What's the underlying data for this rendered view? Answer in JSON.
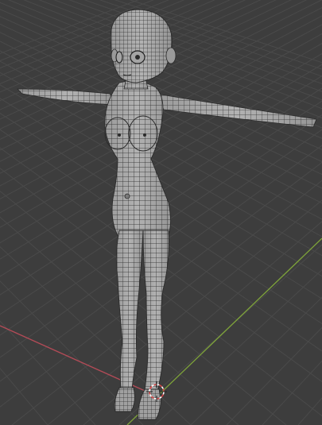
{
  "viewport": {
    "background": "#3d3d3d",
    "grid_color": "#4a4a4a",
    "x_axis_color": "#b34b57",
    "y_axis_color": "#7ea33a"
  },
  "model": {
    "mesh_fill": "#a9a9a9",
    "mesh_shadow": "#8e8e8e",
    "wire_color": "#2b2b2b"
  },
  "scene": {
    "cursor_icon": "3d-cursor-icon",
    "cursor_color_a": "#ffffff",
    "cursor_color_b": "#d24545"
  }
}
